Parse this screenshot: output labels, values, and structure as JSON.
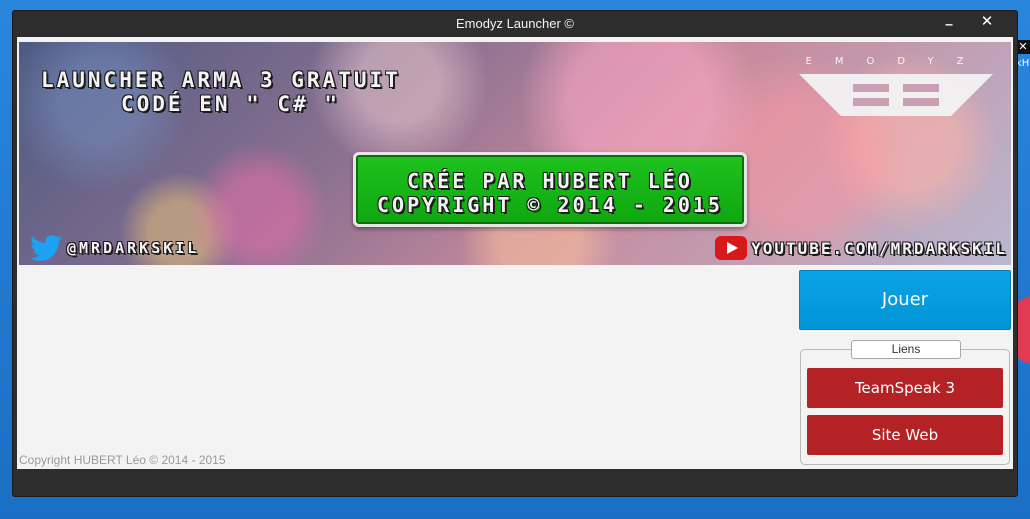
{
  "window": {
    "title": "Emodyz Launcher ©",
    "minimize_label": "_",
    "close_label": "✕"
  },
  "banner": {
    "line1": "LAUNCHER ARMA 3 GRATUIT",
    "line2": "CODÉ EN \" C# \"",
    "logo_letters": "EMODYZ",
    "credit_line1": "CRÉE PAR HUBERT LÉO",
    "credit_line2": "COPYRIGHT © 2014 - 2015",
    "twitter_handle": "@MRDARKSKIL",
    "youtube_url": "YOUTUBE.COM/MRDARKSKIL"
  },
  "actions": {
    "play_label": "Jouer"
  },
  "links": {
    "legend": "Liens",
    "teamspeak_label": "TeamSpeak 3",
    "website_label": "Site Web"
  },
  "footer": {
    "copyright": "Copyright HUBERT Léo © 2014 - 2015"
  },
  "desktop": {
    "mini_text": "kH"
  },
  "colors": {
    "play_button": "#0294d6",
    "link_buttons": "#b52226",
    "credit_box": "#14b514",
    "youtube_red": "#d7191c",
    "twitter_blue": "#1da1f2"
  }
}
